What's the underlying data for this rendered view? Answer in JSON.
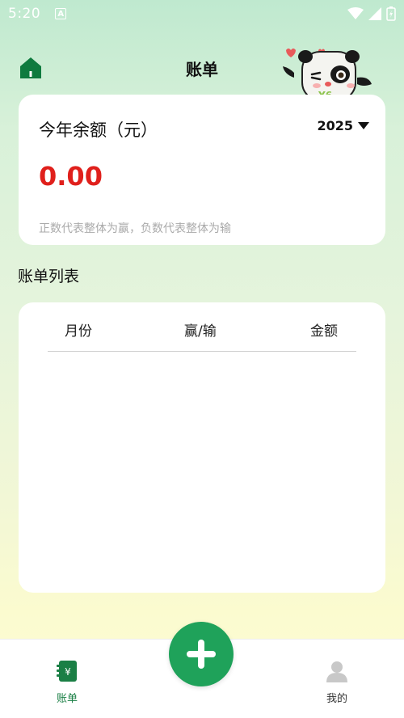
{
  "status_bar": {
    "time": "5:20",
    "notification_icon": "A"
  },
  "header": {
    "title": "账单",
    "home_icon": "home-icon",
    "mascot": "panda-mascot"
  },
  "balance_card": {
    "label": "今年余额（元）",
    "year": "2025",
    "value": "0.00",
    "hint": "正数代表整体为赢，负数代表整体为输"
  },
  "bill_list": {
    "title": "账单列表",
    "columns": [
      "月份",
      "赢/输",
      "金额"
    ],
    "rows": []
  },
  "bottom_nav": {
    "items": [
      {
        "label": "账单",
        "icon": "bill-icon",
        "active": true
      },
      {
        "label": "我的",
        "icon": "user-icon",
        "active": false
      }
    ],
    "add_icon": "plus-icon"
  },
  "colors": {
    "primary": "#1fa25a",
    "balance": "#e0201c",
    "hint": "#aaaaaa"
  }
}
